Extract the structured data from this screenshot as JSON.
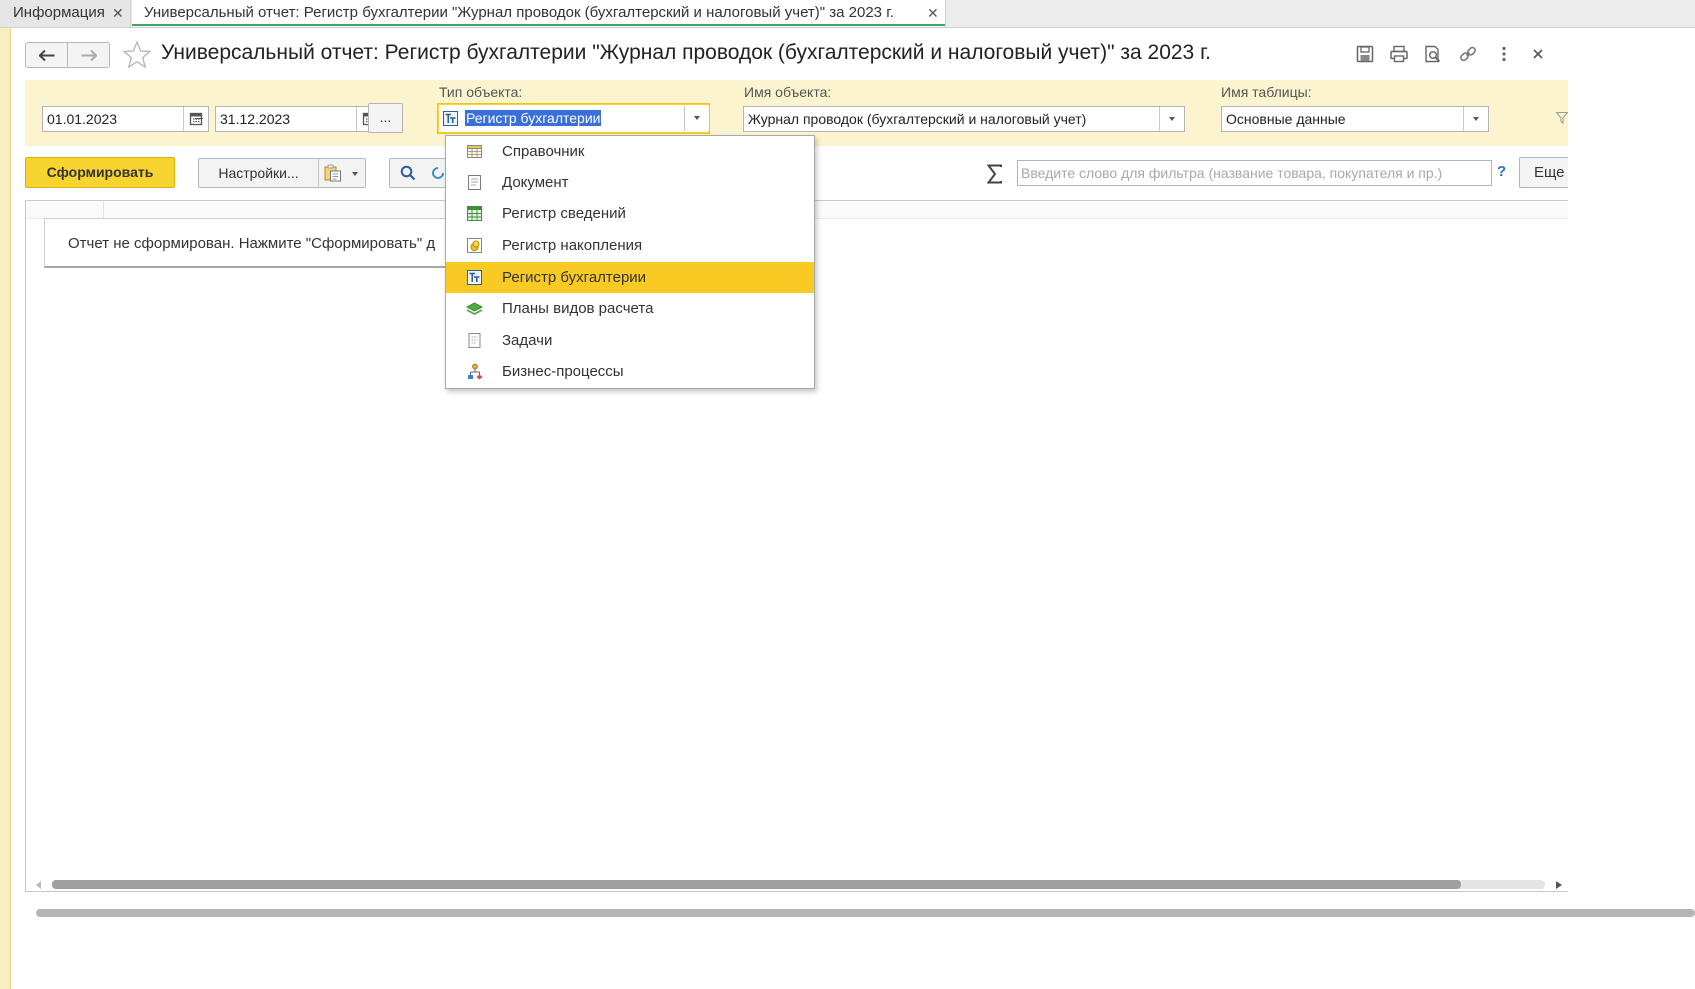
{
  "tabs": [
    {
      "label": "Информация",
      "active": false
    },
    {
      "label": "Универсальный отчет: Регистр бухгалтерии \"Журнал проводок (бухгалтерский и налоговый учет)\" за 2023 г.",
      "active": true
    }
  ],
  "window": {
    "title": "Универсальный отчет: Регистр бухгалтерии \"Журнал проводок (бухгалтерский и налоговый учет)\" за 2023 г.",
    "toolbar_icons": [
      "save-icon",
      "print-icon",
      "preview-icon",
      "link-icon",
      "more-icon",
      "close-icon"
    ]
  },
  "filters": {
    "date_from": "01.01.2023",
    "date_separator": "–",
    "date_to": "31.12.2023",
    "period_button": "...",
    "object_type_label": "Тип объекта:",
    "object_type_value": "Регистр бухгалтерии",
    "object_name_label": "Имя объекта:",
    "object_name_value": "Журнал проводок (бухгалтерский и налоговый учет)",
    "table_name_label": "Имя таблицы:",
    "table_name_value": "Основные данные"
  },
  "commands": {
    "generate_label": "Сформировать",
    "settings_label": "Настройки...",
    "sum_symbol": "Σ",
    "search_placeholder": "Введите слово для фильтра (название товара, покупателя и пр.)",
    "help_symbol": "?",
    "more_label": "Еще"
  },
  "report": {
    "notice": "Отчет не сформирован. Нажмите \"Сформировать\" д"
  },
  "dropdown": {
    "selected_index": 4,
    "items": [
      {
        "label": "Справочник",
        "icon": "catalog-icon"
      },
      {
        "label": "Документ",
        "icon": "document-icon"
      },
      {
        "label": "Регистр сведений",
        "icon": "info-register-icon"
      },
      {
        "label": "Регистр накопления",
        "icon": "accumulation-register-icon"
      },
      {
        "label": "Регистр бухгалтерии",
        "icon": "accounting-register-icon"
      },
      {
        "label": "Планы видов расчета",
        "icon": "calculation-plans-icon"
      },
      {
        "label": "Задачи",
        "icon": "tasks-icon"
      },
      {
        "label": "Бизнес-процессы",
        "icon": "business-process-icon"
      }
    ]
  },
  "colors": {
    "accent_yellow": "#f7d430",
    "selected_item": "#f9ca24",
    "panel_background": "#fbf4cf",
    "active_tab_underline": "#3aa564",
    "text_selection": "#3b6fd8"
  }
}
